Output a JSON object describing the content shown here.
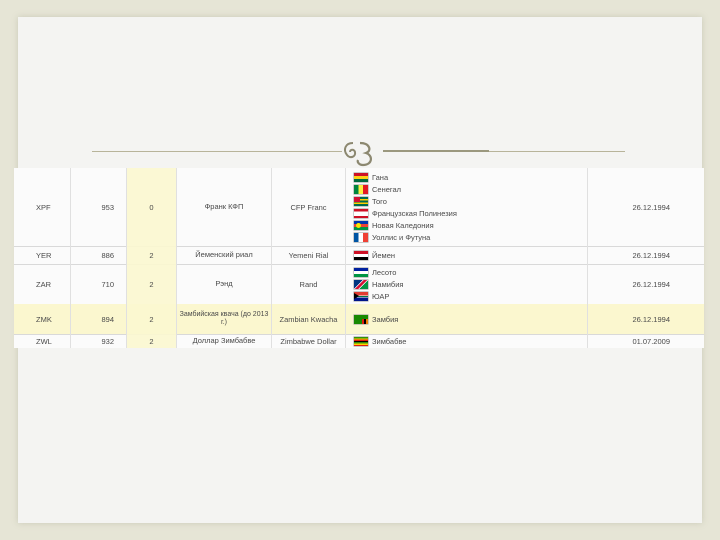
{
  "rows": [
    {
      "code": "XPF",
      "num": "953",
      "digits": "0",
      "name_ru": "Франк КФП",
      "name_en": "CFP Franc",
      "countries": [
        {
          "flag": "ghana-flag",
          "name": "Гана"
        },
        {
          "flag": "senegal-flag",
          "name": "Сенегал"
        },
        {
          "flag": "togo-flag",
          "name": "Того"
        },
        {
          "flag": "french-polynesia-flag",
          "name": "Французская Полинезия"
        },
        {
          "flag": "new-caledonia-flag",
          "name": "Новая Каледония"
        },
        {
          "flag": "wallis-futuna-flag",
          "name": "Уоллис и Футуна"
        }
      ],
      "date": "26.12.1994"
    },
    {
      "code": "YER",
      "num": "886",
      "digits": "2",
      "name_ru": "Йеменский риал",
      "name_en": "Yemeni Rial",
      "countries": [
        {
          "flag": "yemen-flag",
          "name": "Йемен"
        }
      ],
      "date": "26.12.1994"
    },
    {
      "code": "ZAR",
      "num": "710",
      "digits": "2",
      "name_ru": "Рэнд",
      "name_en": "Rand",
      "countries": [
        {
          "flag": "lesotho-flag",
          "name": "Лесото"
        },
        {
          "flag": "namibia-flag",
          "name": "Намибия"
        },
        {
          "flag": "south-africa-flag",
          "name": "ЮАР"
        }
      ],
      "date": "26.12.1994"
    },
    {
      "code": "ZMK",
      "num": "894",
      "digits": "2",
      "name_ru": "Замбийская квача (до 2013 г.)",
      "name_en": "Zambian Kwacha",
      "countries": [
        {
          "flag": "zambia-flag",
          "name": "Замбия"
        }
      ],
      "date": "26.12.1994"
    },
    {
      "code": "ZWL",
      "num": "932",
      "digits": "2",
      "name_ru": "Доллар Зимбабве",
      "name_en": "Zimbabwe Dollar",
      "countries": [
        {
          "flag": "zimbabwe-flag",
          "name": "Зимбабве"
        }
      ],
      "date": "01.07.2009"
    }
  ]
}
